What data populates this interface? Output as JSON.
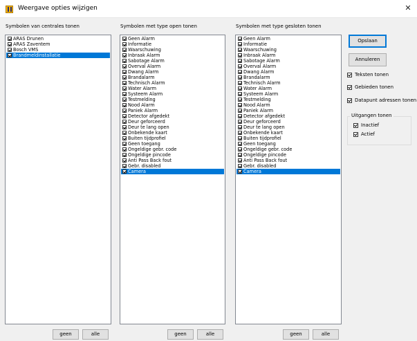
{
  "window": {
    "title": "Weergave opties wijzigen",
    "close_glyph": "✕"
  },
  "columns": [
    {
      "label": "Symbolen van centrales tonen",
      "items": [
        {
          "label": "ARAS Drunen",
          "checked": true,
          "selected": false
        },
        {
          "label": "ARAS Zaventem",
          "checked": true,
          "selected": false
        },
        {
          "label": "Bosch VMS",
          "checked": true,
          "selected": false
        },
        {
          "label": "Brandmeldinstallatie",
          "checked": true,
          "selected": true
        }
      ],
      "none_label": "geen",
      "all_label": "alle"
    },
    {
      "label": "Symbolen met type open tonen",
      "items": [
        {
          "label": "Geen Alarm",
          "checked": true,
          "selected": false
        },
        {
          "label": "Informatie",
          "checked": true,
          "selected": false
        },
        {
          "label": "Waarschuwing",
          "checked": true,
          "selected": false
        },
        {
          "label": "Inbraak Alarm",
          "checked": true,
          "selected": false
        },
        {
          "label": "Sabotage Alarm",
          "checked": true,
          "selected": false
        },
        {
          "label": "Overval Alarm",
          "checked": true,
          "selected": false
        },
        {
          "label": "Dwang Alarm",
          "checked": true,
          "selected": false
        },
        {
          "label": "Brandalarm",
          "checked": true,
          "selected": false
        },
        {
          "label": "Technisch Alarm",
          "checked": true,
          "selected": false
        },
        {
          "label": "Water Alarm",
          "checked": true,
          "selected": false
        },
        {
          "label": "Systeem Alarm",
          "checked": true,
          "selected": false
        },
        {
          "label": "Testmelding",
          "checked": true,
          "selected": false
        },
        {
          "label": "Nood Alarm",
          "checked": true,
          "selected": false
        },
        {
          "label": "Paniek Alarm",
          "checked": true,
          "selected": false
        },
        {
          "label": "Detector afgedekt",
          "checked": true,
          "selected": false
        },
        {
          "label": "Deur geforceerd",
          "checked": true,
          "selected": false
        },
        {
          "label": "Deur te lang open",
          "checked": true,
          "selected": false
        },
        {
          "label": "Onbekende kaart",
          "checked": true,
          "selected": false
        },
        {
          "label": "Buiten tijdprofiel",
          "checked": true,
          "selected": false
        },
        {
          "label": "Geen toegang",
          "checked": true,
          "selected": false
        },
        {
          "label": "Ongeldige gebr. code",
          "checked": true,
          "selected": false
        },
        {
          "label": "Ongeldige pincode",
          "checked": true,
          "selected": false
        },
        {
          "label": "Anti Pass Back fout",
          "checked": true,
          "selected": false
        },
        {
          "label": "Gebr. disabled",
          "checked": true,
          "selected": false
        },
        {
          "label": "Camera",
          "checked": true,
          "selected": true
        }
      ],
      "none_label": "geen",
      "all_label": "alle"
    },
    {
      "label": "Symbolen met type gesloten tonen",
      "items": [
        {
          "label": "Geen Alarm",
          "checked": true,
          "selected": false
        },
        {
          "label": "Informatie",
          "checked": true,
          "selected": false
        },
        {
          "label": "Waarschuwing",
          "checked": true,
          "selected": false
        },
        {
          "label": "Inbraak Alarm",
          "checked": true,
          "selected": false
        },
        {
          "label": "Sabotage Alarm",
          "checked": true,
          "selected": false
        },
        {
          "label": "Overval Alarm",
          "checked": true,
          "selected": false
        },
        {
          "label": "Dwang Alarm",
          "checked": true,
          "selected": false
        },
        {
          "label": "Brandalarm",
          "checked": true,
          "selected": false
        },
        {
          "label": "Technisch Alarm",
          "checked": true,
          "selected": false
        },
        {
          "label": "Water Alarm",
          "checked": true,
          "selected": false
        },
        {
          "label": "Systeem Alarm",
          "checked": true,
          "selected": false
        },
        {
          "label": "Testmelding",
          "checked": true,
          "selected": false
        },
        {
          "label": "Nood Alarm",
          "checked": true,
          "selected": false
        },
        {
          "label": "Paniek Alarm",
          "checked": true,
          "selected": false
        },
        {
          "label": "Detector afgedekt",
          "checked": true,
          "selected": false
        },
        {
          "label": "Deur geforceerd",
          "checked": true,
          "selected": false
        },
        {
          "label": "Deur te lang open",
          "checked": true,
          "selected": false
        },
        {
          "label": "Onbekende kaart",
          "checked": true,
          "selected": false
        },
        {
          "label": "Buiten tijdprofiel",
          "checked": true,
          "selected": false
        },
        {
          "label": "Geen toegang",
          "checked": true,
          "selected": false
        },
        {
          "label": "Ongeldige gebr. code",
          "checked": true,
          "selected": false
        },
        {
          "label": "Ongeldige pincode",
          "checked": true,
          "selected": false
        },
        {
          "label": "Anti Pass Back fout",
          "checked": true,
          "selected": false
        },
        {
          "label": "Gebr. disabled",
          "checked": true,
          "selected": false
        },
        {
          "label": "Camera",
          "checked": true,
          "selected": true
        }
      ],
      "none_label": "geen",
      "all_label": "alle"
    }
  ],
  "actions": {
    "save_label": "Opslaan",
    "cancel_label": "Annuleren"
  },
  "options": {
    "show_texts": {
      "label": "Teksten tonen",
      "checked": true
    },
    "show_areas": {
      "label": "Gebieden tonen",
      "checked": true
    },
    "show_datapoint_addresses": {
      "label": "Datapunt adressen tonen",
      "checked": true
    }
  },
  "outputs_group": {
    "title": "Uitgangen tonen",
    "inactive": {
      "label": "Inactief",
      "checked": true
    },
    "active": {
      "label": "Actief",
      "checked": true
    }
  },
  "colors": {
    "selection": "#0078d7",
    "window_bg": "#f0f0f0",
    "list_bg": "#ffffff"
  }
}
